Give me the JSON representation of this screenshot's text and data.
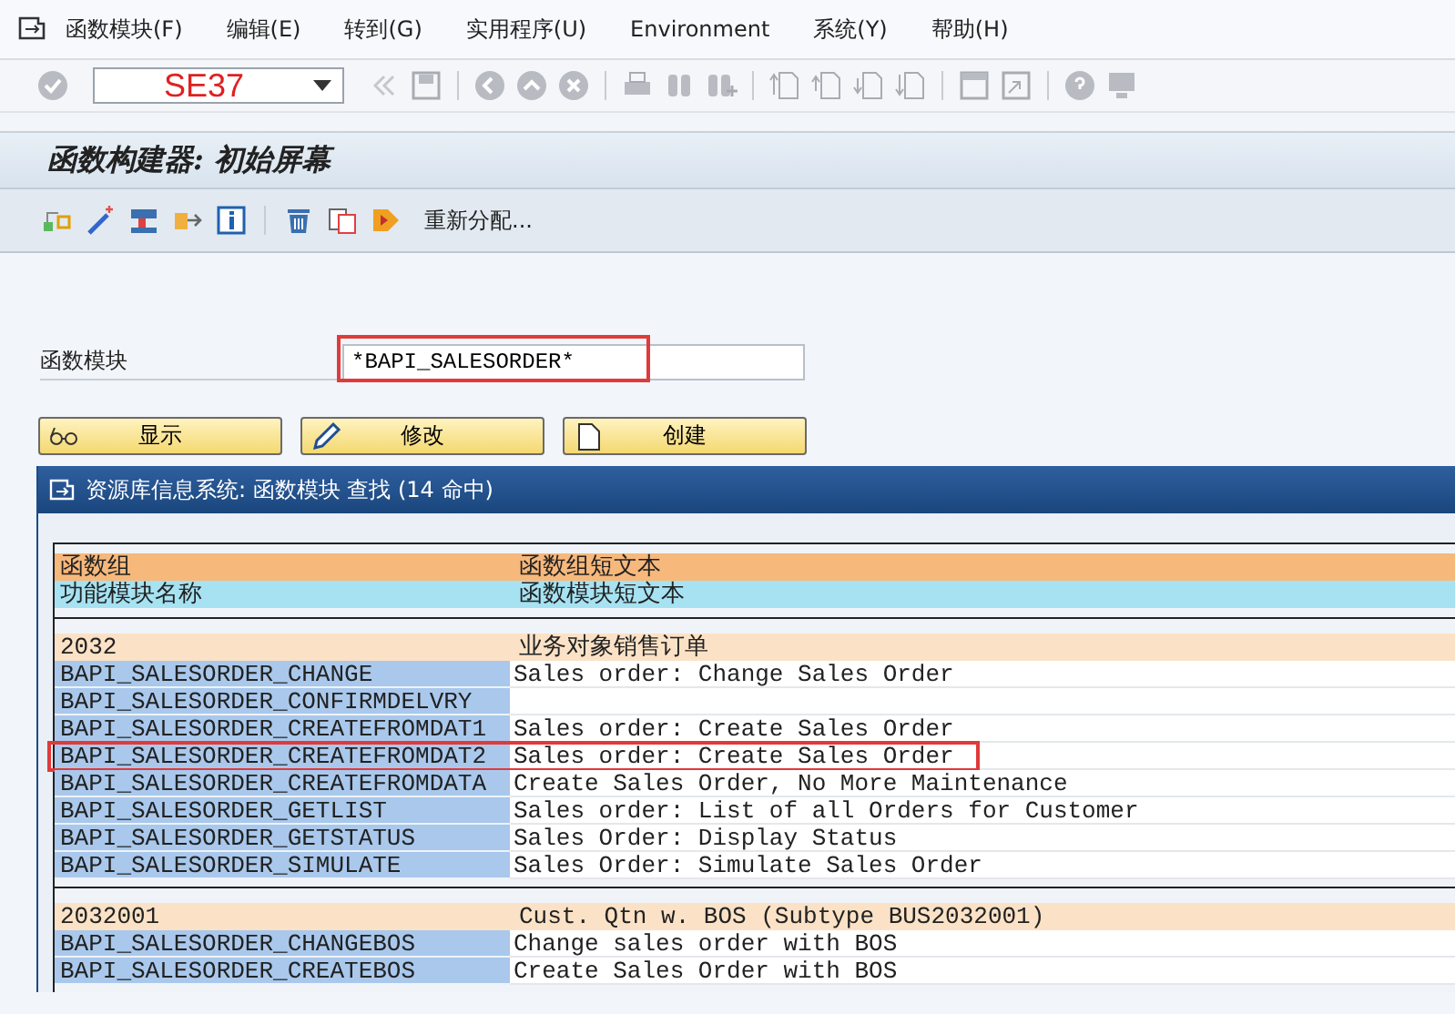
{
  "menu": [
    {
      "label": "函数模块(F)"
    },
    {
      "label": "编辑(E)"
    },
    {
      "label": "转到(G)"
    },
    {
      "label": "实用程序(U)"
    },
    {
      "label": "Environment"
    },
    {
      "label": "系统(Y)"
    },
    {
      "label": "帮助(H)"
    }
  ],
  "command_field": {
    "value": "SE37"
  },
  "screen_title": "函数构建器: 初始屏幕",
  "app_toolbar": {
    "reassign_label": "重新分配..."
  },
  "field": {
    "label": "函数模块",
    "value": "*BAPI_SALESORDER*",
    "highlighted": true
  },
  "buttons": [
    {
      "kind": "display",
      "label": "显示"
    },
    {
      "kind": "change",
      "label": "修改"
    },
    {
      "kind": "create",
      "label": "创建"
    }
  ],
  "dialog": {
    "title": "资源库信息系统: 函数模块 查找 (14 命中)",
    "header": {
      "group": "函数组",
      "group_text": "函数组短文本",
      "module": "功能模块名称",
      "module_text": "函数模块短文本"
    },
    "groups": [
      {
        "group": "2032",
        "text": "业务对象销售订单",
        "modules": [
          {
            "name": "BAPI_SALESORDER_CHANGE",
            "text": "Sales order: Change Sales Order",
            "highlighted": false
          },
          {
            "name": "BAPI_SALESORDER_CONFIRMDELVRY",
            "highlighted": false
          },
          {
            "name": "BAPI_SALESORDER_CREATEFROMDAT1",
            "text": "Sales order: Create Sales Order",
            "highlighted": false
          },
          {
            "name": "BAPI_SALESORDER_CREATEFROMDAT2",
            "text": "Sales order: Create Sales Order",
            "highlighted": true
          },
          {
            "name": "BAPI_SALESORDER_CREATEFROMDATA",
            "text": "Create Sales Order, No More Maintenance",
            "highlighted": false
          },
          {
            "name": "BAPI_SALESORDER_GETLIST",
            "text": "Sales order: List of all Orders for Customer",
            "highlighted": false
          },
          {
            "name": "BAPI_SALESORDER_GETSTATUS",
            "text": "Sales Order: Display Status",
            "highlighted": false
          },
          {
            "name": "BAPI_SALESORDER_SIMULATE",
            "text": "Sales Order: Simulate Sales Order",
            "highlighted": false
          }
        ]
      },
      {
        "group": "2032001",
        "text": "Cust. Qtn w. BOS (Subtype BUS2032001)",
        "modules": [
          {
            "name": "BAPI_SALESORDER_CHANGEBOS",
            "text": "Change sales order with BOS",
            "highlighted": false
          },
          {
            "name": "BAPI_SALESORDER_CREATEBOS",
            "text": "Create Sales Order with BOS",
            "highlighted": false
          }
        ]
      }
    ]
  }
}
